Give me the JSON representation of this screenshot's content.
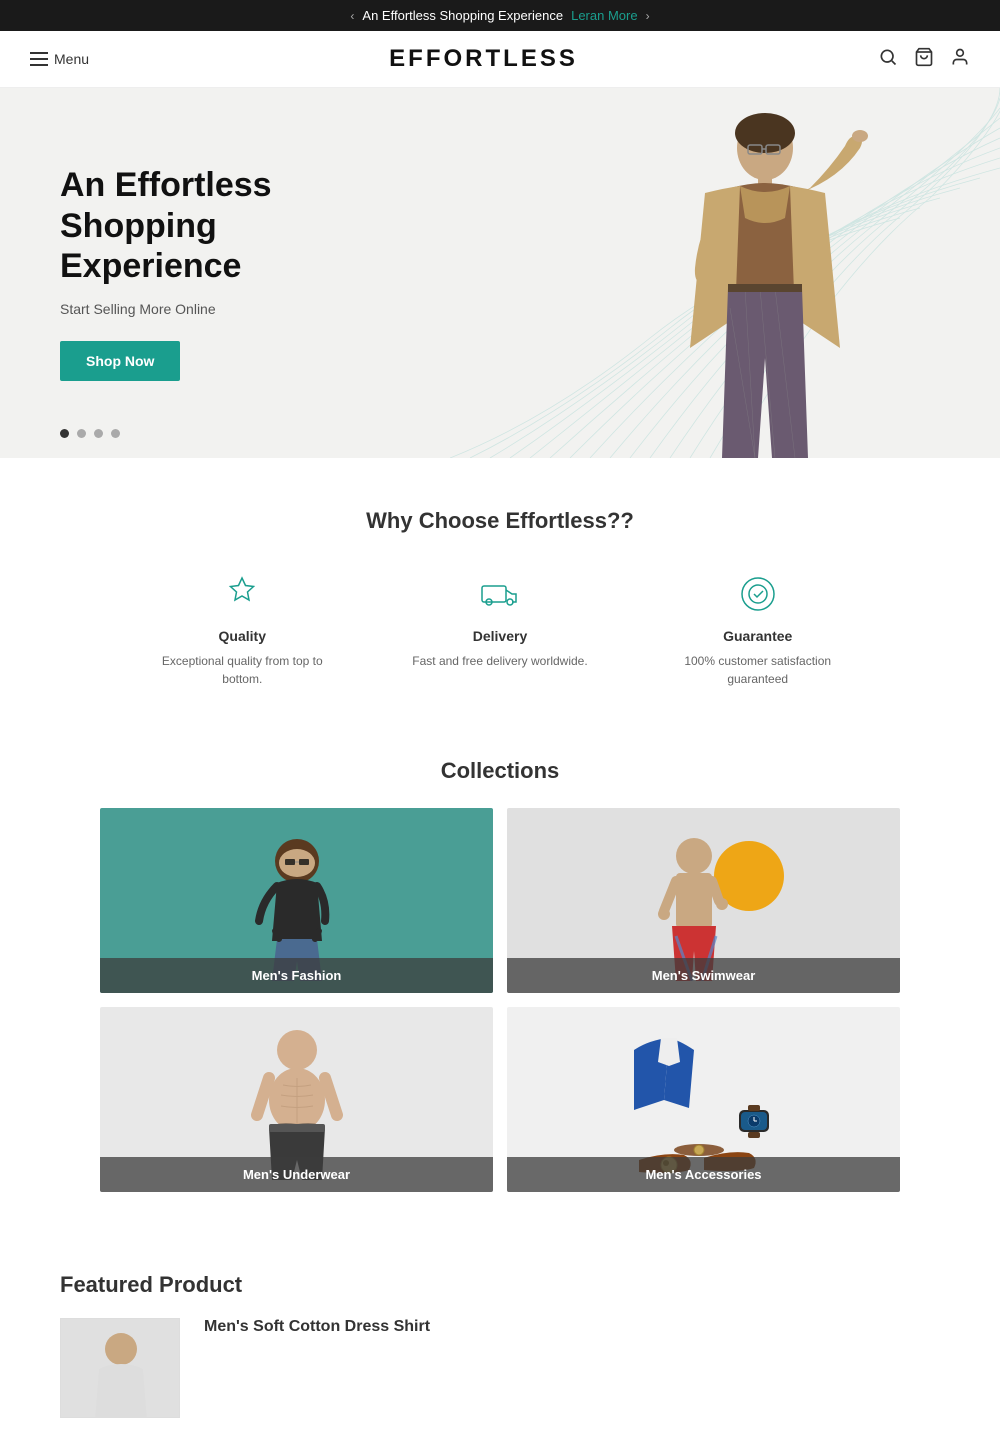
{
  "announcement": {
    "text": "An Effortless Shopping Experience",
    "link_text": "Leran More",
    "prev_arrow": "‹",
    "next_arrow": "›"
  },
  "header": {
    "menu_label": "Menu",
    "logo": "EFFORTLESS",
    "icons": {
      "search": "🔍",
      "cart": "🛍",
      "user": "👤"
    }
  },
  "hero": {
    "title": "An Effortless Shopping Experience",
    "subtitle": "Start Selling More Online",
    "cta_label": "Shop Now",
    "dots": [
      true,
      false,
      false,
      false
    ]
  },
  "why": {
    "title": "Why Choose Effortless??",
    "cards": [
      {
        "id": "quality",
        "title": "Quality",
        "desc": "Exceptional quality from top to bottom."
      },
      {
        "id": "delivery",
        "title": "Delivery",
        "desc": "Fast and free delivery worldwide."
      },
      {
        "id": "guarantee",
        "title": "Guarantee",
        "desc": "100% customer satisfaction guaranteed"
      }
    ]
  },
  "collections": {
    "title": "Collections",
    "items": [
      {
        "id": "mens-fashion",
        "label": "Men's Fashion",
        "color_class": "coll-1"
      },
      {
        "id": "mens-swimwear",
        "label": "Men's Swimwear",
        "color_class": "coll-2"
      },
      {
        "id": "mens-underwear",
        "label": "Men's Underwear",
        "color_class": "coll-3"
      },
      {
        "id": "mens-accessories",
        "label": "Men's Accessories",
        "color_class": "coll-4"
      }
    ]
  },
  "featured": {
    "title": "Featured Product",
    "product_name": "Men's Soft Cotton Dress Shirt"
  }
}
